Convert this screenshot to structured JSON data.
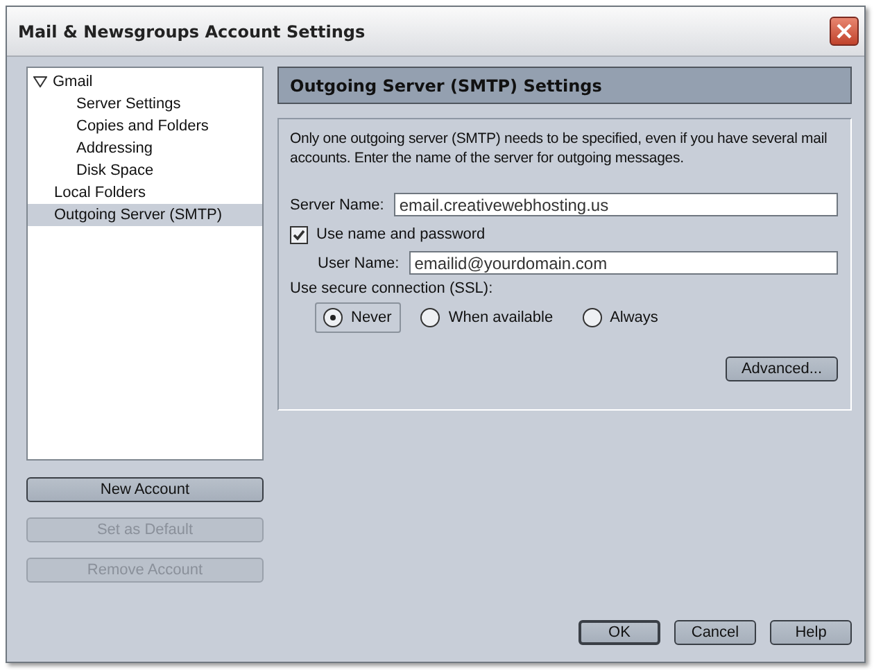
{
  "window": {
    "title": "Mail & Newsgroups Account Settings"
  },
  "tree": [
    {
      "label": "Gmail",
      "expanded": true,
      "selected": false,
      "children": [
        {
          "label": "Server Settings",
          "selected": false
        },
        {
          "label": "Copies and Folders",
          "selected": false
        },
        {
          "label": "Addressing",
          "selected": false
        },
        {
          "label": "Disk Space",
          "selected": false
        }
      ]
    },
    {
      "label": "Local Folders",
      "selected": false
    },
    {
      "label": "Outgoing Server (SMTP)",
      "selected": true
    }
  ],
  "account_buttons": [
    {
      "label": "New Account",
      "disabled": false
    },
    {
      "label": "Set as Default",
      "disabled": true
    },
    {
      "label": "Remove Account",
      "disabled": true
    }
  ],
  "panel": {
    "title": "Outgoing Server (SMTP) Settings",
    "description": "Only one outgoing server (SMTP) needs to be specified, even if you have several mail accounts. Enter the name of the server for outgoing messages.",
    "server_name": {
      "label": "Server Name:",
      "value": "email.creativewebhosting.us"
    },
    "use_auth": {
      "label": "Use name and password",
      "checked": true
    },
    "user_name": {
      "label": "User Name:",
      "value": "emailid@yourdomain.com"
    },
    "ssl": {
      "label": "Use secure connection (SSL):",
      "options": [
        {
          "label": "Never",
          "selected": true
        },
        {
          "label": "When available",
          "selected": false
        },
        {
          "label": "Always",
          "selected": false
        }
      ]
    },
    "advanced_button": "Advanced..."
  },
  "dialog_buttons": [
    {
      "label": "OK",
      "default": true
    },
    {
      "label": "Cancel",
      "default": false
    },
    {
      "label": "Help",
      "default": false
    }
  ]
}
